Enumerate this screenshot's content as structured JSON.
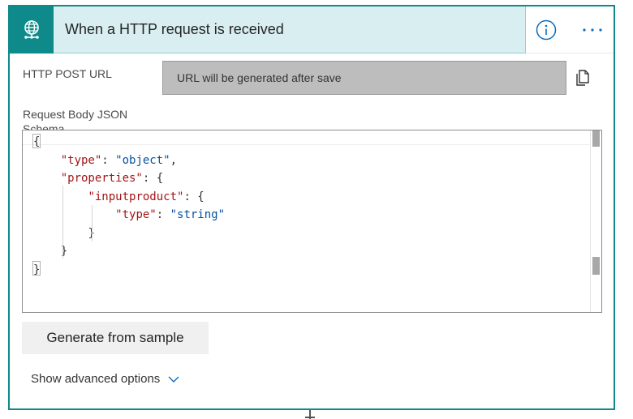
{
  "trigger": {
    "title": "When a HTTP request is received",
    "icon": "globe-network-icon",
    "accent_color": "#0f8a8a",
    "header_bg": "#d8eef0"
  },
  "header_actions": {
    "info_icon": "info-icon",
    "more_icon": "more-options-icon"
  },
  "http_post_url": {
    "label": "HTTP POST URL",
    "value": "URL will be generated after save",
    "copy_icon": "copy-icon"
  },
  "schema": {
    "label": "Request Body JSON Schema",
    "lines": [
      {
        "indent": "",
        "parts": [
          {
            "t": "{",
            "c": "pun"
          }
        ]
      },
      {
        "indent": "    ",
        "parts": [
          {
            "t": "\"type\"",
            "c": "key"
          },
          {
            "t": ": ",
            "c": "pun"
          },
          {
            "t": "\"object\"",
            "c": "str"
          },
          {
            "t": ",",
            "c": "pun"
          }
        ]
      },
      {
        "indent": "    ",
        "parts": [
          {
            "t": "\"properties\"",
            "c": "key"
          },
          {
            "t": ": {",
            "c": "pun"
          }
        ]
      },
      {
        "indent": "        ",
        "parts": [
          {
            "t": "\"inputproduct\"",
            "c": "key"
          },
          {
            "t": ": {",
            "c": "pun"
          }
        ]
      },
      {
        "indent": "            ",
        "parts": [
          {
            "t": "\"type\"",
            "c": "key"
          },
          {
            "t": ": ",
            "c": "pun"
          },
          {
            "t": "\"string\"",
            "c": "str"
          }
        ]
      },
      {
        "indent": "        ",
        "parts": [
          {
            "t": "}",
            "c": "pun"
          }
        ]
      },
      {
        "indent": "    ",
        "parts": [
          {
            "t": "}",
            "c": "pun"
          }
        ]
      },
      {
        "indent": "",
        "parts": [
          {
            "t": "}",
            "c": "pun"
          }
        ]
      }
    ]
  },
  "actions": {
    "generate_label": "Generate from sample",
    "advanced_label": "Show advanced options",
    "advanced_icon": "chevron-down-icon"
  }
}
